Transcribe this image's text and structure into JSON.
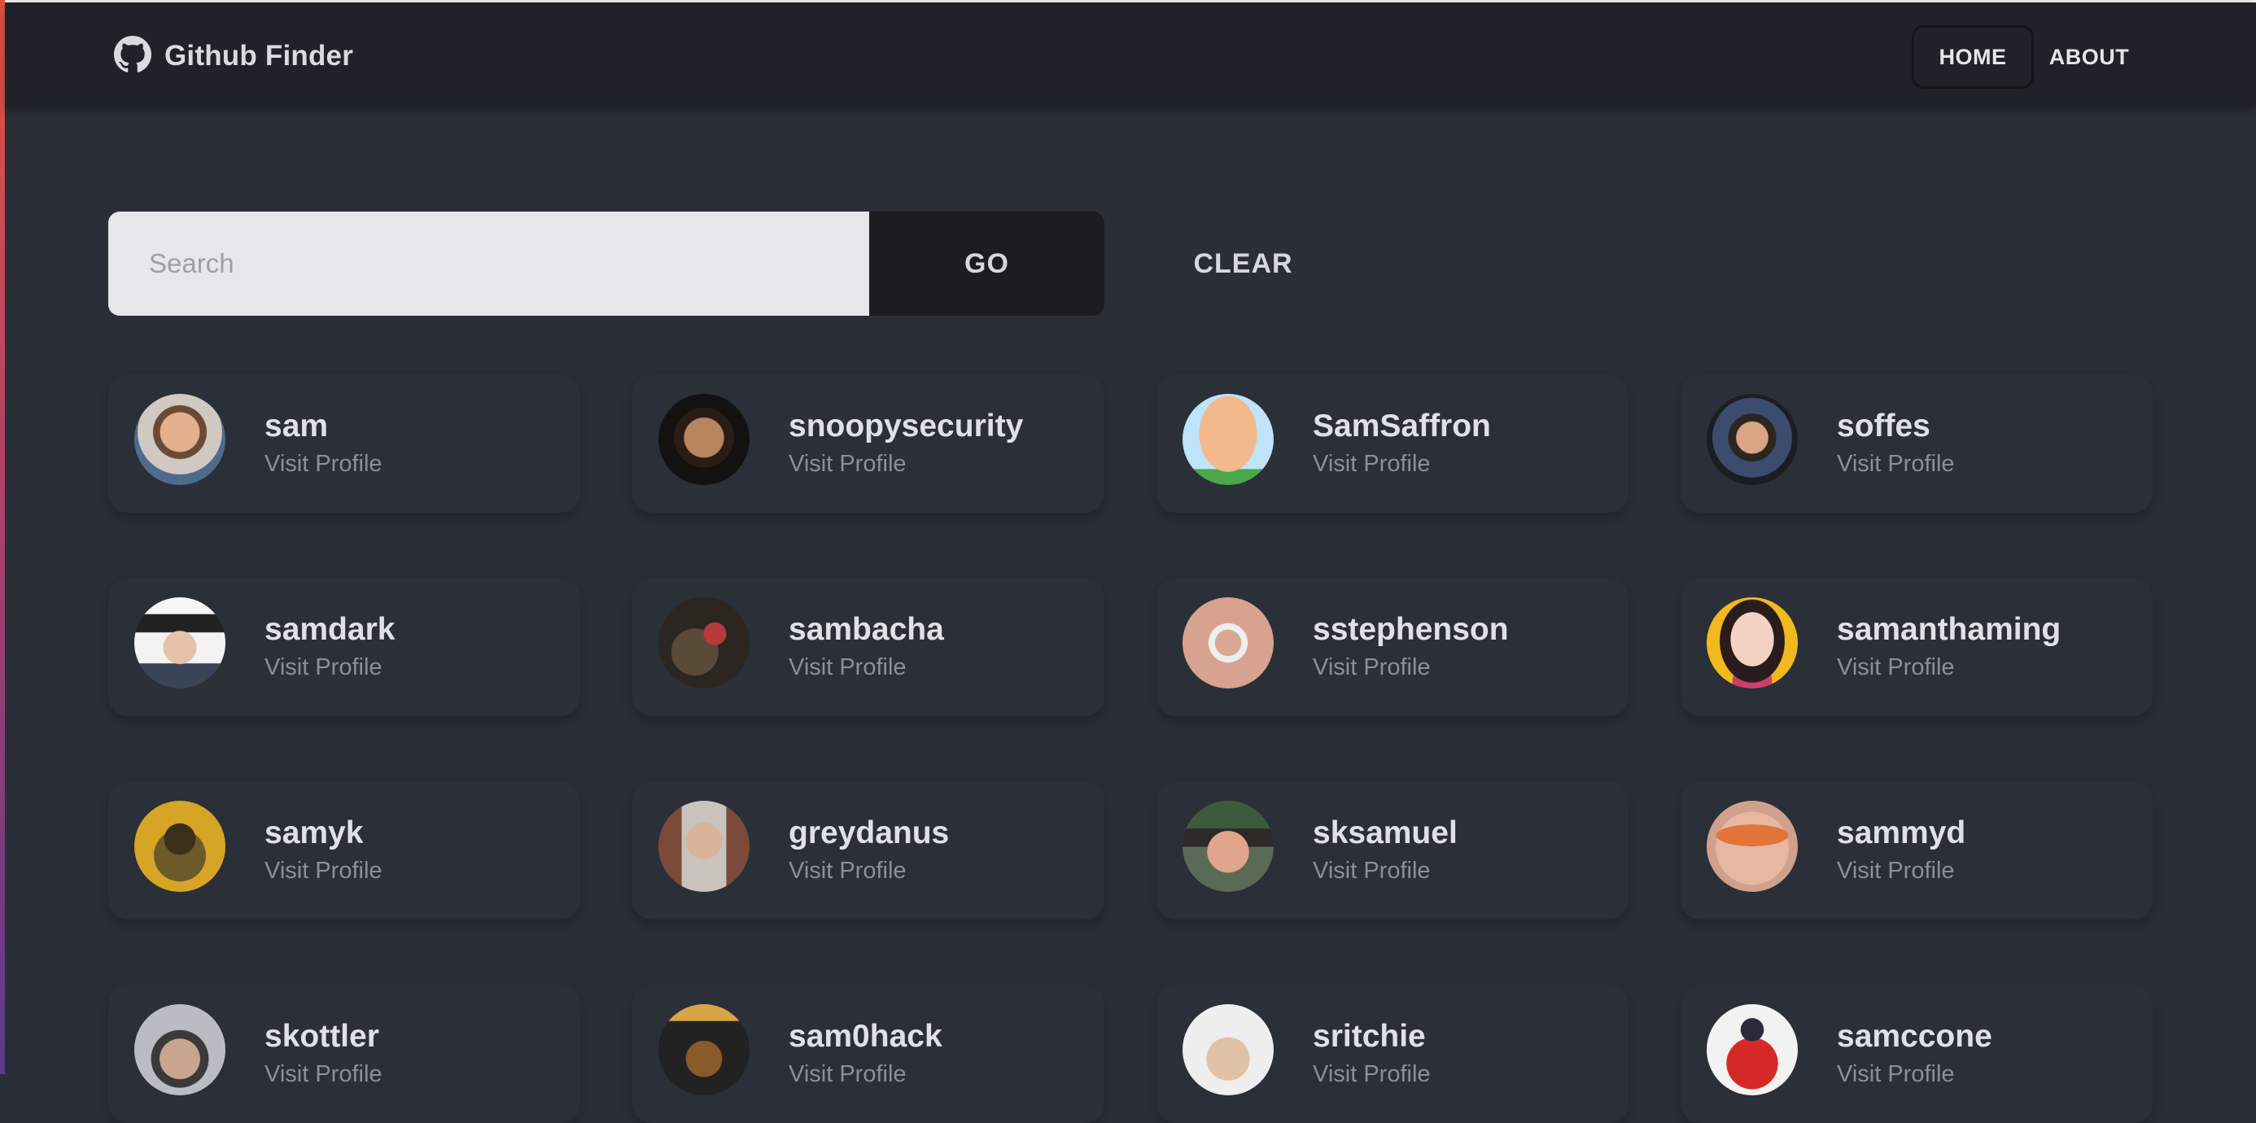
{
  "nav": {
    "brand": "Github Finder",
    "links": [
      {
        "label": "HOME"
      },
      {
        "label": "ABOUT"
      }
    ]
  },
  "search": {
    "placeholder": "Search",
    "go_label": "GO",
    "clear_label": "CLEAR"
  },
  "users": [
    {
      "login": "sam",
      "link": "Visit Profile"
    },
    {
      "login": "snoopysecurity",
      "link": "Visit Profile"
    },
    {
      "login": "SamSaffron",
      "link": "Visit Profile"
    },
    {
      "login": "soffes",
      "link": "Visit Profile"
    },
    {
      "login": "samdark",
      "link": "Visit Profile"
    },
    {
      "login": "sambacha",
      "link": "Visit Profile"
    },
    {
      "login": "sstephenson",
      "link": "Visit Profile"
    },
    {
      "login": "samanthaming",
      "link": "Visit Profile"
    },
    {
      "login": "samyk",
      "link": "Visit Profile"
    },
    {
      "login": "greydanus",
      "link": "Visit Profile"
    },
    {
      "login": "sksamuel",
      "link": "Visit Profile"
    },
    {
      "login": "sammyd",
      "link": "Visit Profile"
    },
    {
      "login": "skottler",
      "link": "Visit Profile"
    },
    {
      "login": "sam0hack",
      "link": "Visit Profile"
    },
    {
      "login": "sritchie",
      "link": "Visit Profile"
    },
    {
      "login": "samccone",
      "link": "Visit Profile"
    }
  ]
}
